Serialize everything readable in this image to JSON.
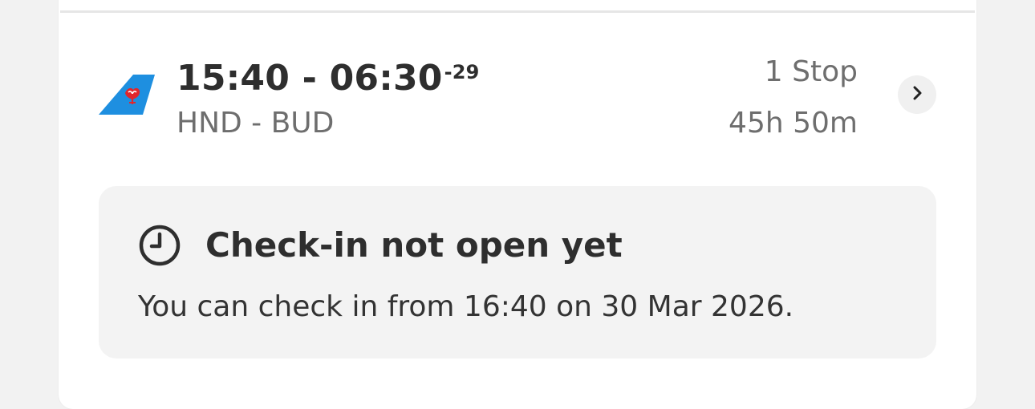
{
  "flight": {
    "departure_time": "15:40",
    "separator": " - ",
    "arrival_time": "06:30",
    "day_offset": "-29",
    "route": "HND - BUD",
    "stops": "1 Stop",
    "duration": "45h 50m",
    "airline_logo": "china-southern-logo"
  },
  "checkin_notice": {
    "icon": "clock-icon",
    "title": "Check-in not open yet",
    "message": "You can check in from 16:40 on 30 Mar 2026."
  },
  "colors": {
    "logo_blue": "#1e8fe0",
    "logo_red": "#e1262c",
    "text_dark": "#2e2e2e",
    "text_muted": "#6e6e6e",
    "notice_bg": "#f3f3f3"
  },
  "icons": {
    "chevron": "chevron-right-icon"
  }
}
